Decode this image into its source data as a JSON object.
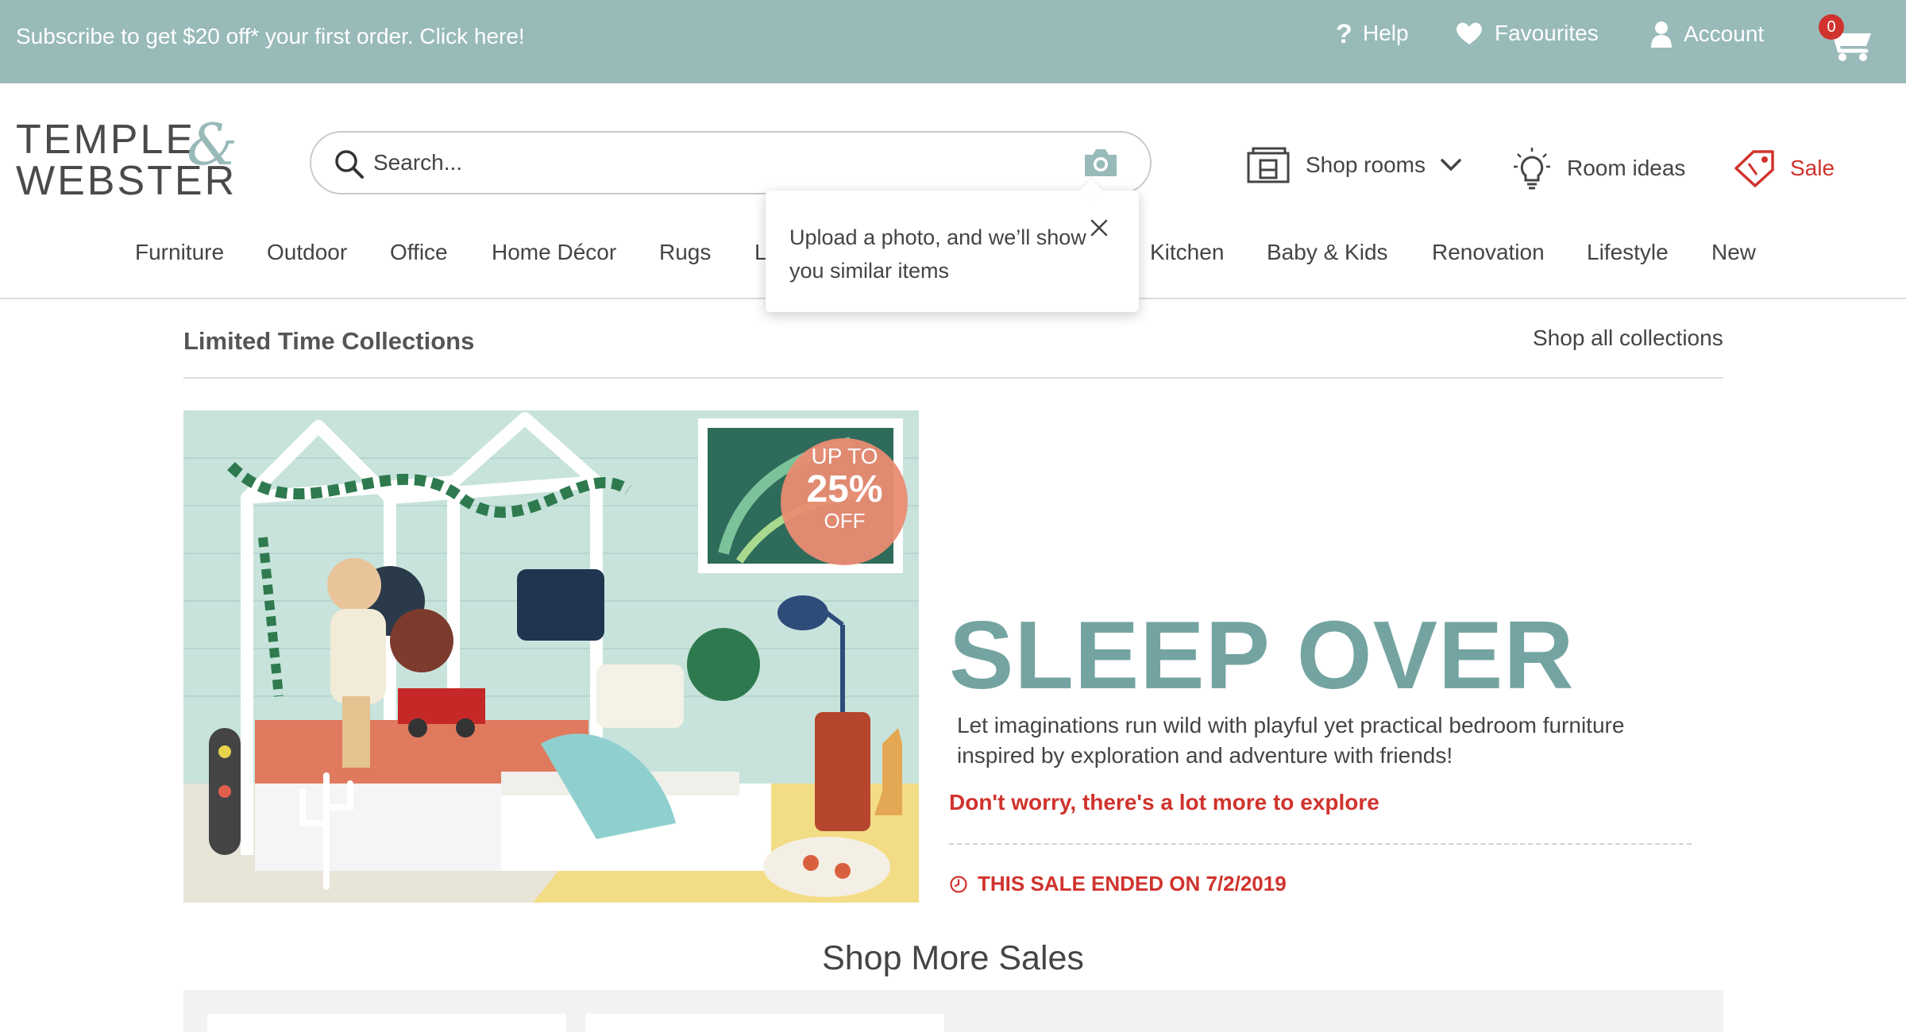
{
  "promo": {
    "text": "Subscribe to get $20 off* your first order. Click here!"
  },
  "utility_nav": {
    "help": "Help",
    "favourites": "Favourites",
    "account": "Account",
    "cart_count": "0"
  },
  "logo": {
    "line1": "TEMPLE",
    "line2": "WEBSTER",
    "amp": "&"
  },
  "search": {
    "placeholder": "Search..."
  },
  "header_links": {
    "shop_rooms": "Shop rooms",
    "room_ideas": "Room ideas",
    "sale": "Sale"
  },
  "categories": [
    "Furniture",
    "Outdoor",
    "Office",
    "Home Décor",
    "Rugs",
    "L",
    "Kitchen",
    "Baby & Kids",
    "Renovation",
    "Lifestyle",
    "New"
  ],
  "popover": {
    "text": "Upload a photo, and we’ll show you similar items"
  },
  "collections": {
    "title": "Limited Time Collections",
    "shop_all": "Shop all collections"
  },
  "hero": {
    "badge_line1": "UP TO",
    "badge_line2": "25%",
    "badge_line3": "OFF",
    "title": "SLEEP OVER",
    "description": "Let imaginations run wild with playful yet practical bedroom furniture inspired by exploration and adventure with friends!",
    "link": "Don't worry, there's a lot more to explore",
    "sale_ended": "THIS SALE ENDED ON 7/2/2019"
  },
  "shop_more": {
    "title": "Shop More Sales"
  },
  "colors": {
    "promo_bg": "#98bab9",
    "accent_teal": "#74a4a2",
    "sale_red": "#d0332d",
    "badge_salmon": "#e98c73"
  }
}
